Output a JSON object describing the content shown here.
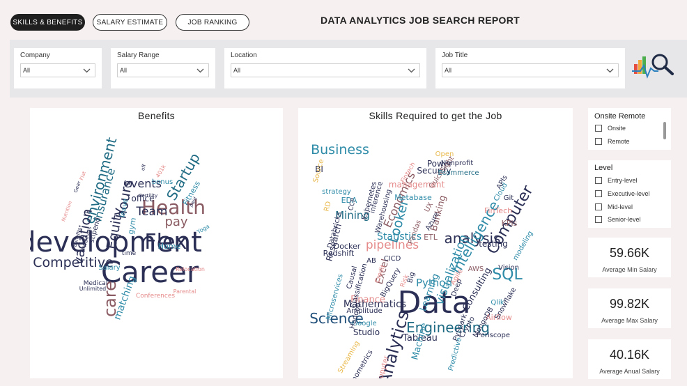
{
  "tabs": {
    "skills_benefits": "SKILLS & BENEFITS",
    "salary_estimate": "SALARY ESTIMATE",
    "job_ranking": "JOB RANKING"
  },
  "header": {
    "title": "DATA ANALYTICS JOB SEARCH REPORT"
  },
  "filters": {
    "company": {
      "label": "Company",
      "value": "All"
    },
    "salary_range": {
      "label": "Salary Range",
      "value": "All"
    },
    "location": {
      "label": "Location",
      "value": "All"
    },
    "job_title": {
      "label": "Job Title",
      "value": "All"
    }
  },
  "icons": {
    "logo": "analytics-magnifier-icon",
    "dropdown": "chevron-down-icon",
    "checkbox": "checkbox-icon"
  },
  "benefits": {
    "title": "Benefits",
    "words": [
      {
        "t": "development",
        "c": "#2b2f55"
      },
      {
        "t": "Career",
        "c": "#2b2f55"
      },
      {
        "t": "Health",
        "c": "#8a5b62"
      },
      {
        "t": "Flex",
        "c": "#2b2f55"
      },
      {
        "t": "care",
        "c": "#8a5b62"
      },
      {
        "t": "environment",
        "c": "#1f6b84"
      },
      {
        "t": "Competitive",
        "c": "#2b2f55"
      },
      {
        "t": "Startup",
        "c": "#1f6b84"
      },
      {
        "t": "hours",
        "c": "#2b2f55"
      },
      {
        "t": "vacation",
        "c": "#2b2f55"
      },
      {
        "t": "Equity",
        "c": "#2b2f55"
      },
      {
        "t": "Team",
        "c": "#2b2f55"
      },
      {
        "t": "pay",
        "c": "#8a5b62"
      },
      {
        "t": "events",
        "c": "#2b2f55"
      },
      {
        "t": "Insurance",
        "c": "#1f6b84"
      },
      {
        "t": "matching",
        "c": "#2e8ba8"
      },
      {
        "t": "office",
        "c": "#2b2f55"
      },
      {
        "t": "Fitness",
        "c": "#2e8ba8"
      },
      {
        "t": "gym",
        "c": "#2e8ba8"
      },
      {
        "t": "Home",
        "c": "#2e8ba8"
      },
      {
        "t": "leave",
        "c": "#2e8ba8"
      },
      {
        "t": "Salary",
        "c": "#2e8ba8"
      },
      {
        "t": "bonus",
        "c": "#2e8ba8"
      },
      {
        "t": "stipend",
        "c": "#2b2f55"
      },
      {
        "t": "Medical",
        "c": "#2b2f55"
      },
      {
        "t": "Unlimited",
        "c": "#2b2f55"
      },
      {
        "t": "Conferences",
        "c": "#e58a8a"
      },
      {
        "t": "Parental",
        "c": "#e58a8a"
      },
      {
        "t": "Relocation",
        "c": "#e58a8a"
      },
      {
        "t": "401k",
        "c": "#e58a8a"
      },
      {
        "t": "k",
        "c": "#2b2f55"
      },
      {
        "t": "time",
        "c": "#2b2f55"
      },
      {
        "t": "Wellness",
        "c": "#2b2f55"
      },
      {
        "t": "benefits",
        "c": "#2b2f55"
      },
      {
        "t": "Yoga",
        "c": "#2e8ba8"
      },
      {
        "t": "Flat",
        "c": "#e58a8a"
      },
      {
        "t": "Gear",
        "c": "#2b2f55"
      },
      {
        "t": "paid",
        "c": "#2b2f55"
      },
      {
        "t": "off",
        "c": "#2b2f55"
      },
      {
        "t": "Fertility",
        "c": "#2b2f55"
      },
      {
        "t": "Nutrition",
        "c": "#e58a8a"
      }
    ]
  },
  "skills": {
    "title": "Skills Required to get the Job",
    "words": [
      {
        "t": "Data",
        "c": "#2b2f55"
      },
      {
        "t": "Engineering",
        "c": "#1f6b84"
      },
      {
        "t": "Analytics",
        "c": "#2b2f55"
      },
      {
        "t": "Science",
        "c": "#1f4e79"
      },
      {
        "t": "SQL",
        "c": "#2e8ba8"
      },
      {
        "t": "Business",
        "c": "#2e8ba8"
      },
      {
        "t": "Computer",
        "c": "#2b2f55"
      },
      {
        "t": "analysis",
        "c": "#2b2f55"
      },
      {
        "t": "Intelligence",
        "c": "#2e8ba8"
      },
      {
        "t": "visualization",
        "c": "#2e8ba8"
      },
      {
        "t": "Python",
        "c": "#2e8ba8"
      },
      {
        "t": "pipelines",
        "c": "#e58a8a"
      },
      {
        "t": "Mining",
        "c": "#1f6b84"
      },
      {
        "t": "Looker",
        "c": "#2e8ba8"
      },
      {
        "t": "Statistics",
        "c": "#2e8ba8"
      },
      {
        "t": "Economics",
        "c": "#8a5b62"
      },
      {
        "t": "Mathematics",
        "c": "#2b2f55"
      },
      {
        "t": "Excel",
        "c": "#8a5b62"
      },
      {
        "t": "Finance",
        "c": "#e58a8a"
      },
      {
        "t": "Tableau",
        "c": "#2b2f55"
      },
      {
        "t": "Consulting",
        "c": "#2b2f55"
      },
      {
        "t": "Machine",
        "c": "#2e8ba8"
      },
      {
        "t": "Learning",
        "c": "#2e8ba8"
      },
      {
        "t": "Research",
        "c": "#2b2f55"
      },
      {
        "t": "Banking",
        "c": "#8a5b62"
      },
      {
        "t": "Security",
        "c": "#2b2f55"
      },
      {
        "t": "management",
        "c": "#e58a8a"
      },
      {
        "t": "Power",
        "c": "#2b2f55"
      },
      {
        "t": "BI",
        "c": "#2b2f55"
      },
      {
        "t": "QuickSight",
        "c": "#8a5b62"
      },
      {
        "t": "Nonprofit",
        "c": "#2b2f55"
      },
      {
        "t": "Ecommerce",
        "c": "#1f6b84"
      },
      {
        "t": "Git",
        "c": "#2b2f55"
      },
      {
        "t": "APIs",
        "c": "#2b2f55"
      },
      {
        "t": "Cloud",
        "c": "#2e8ba8"
      },
      {
        "t": "FinTech",
        "c": "#e58a8a"
      },
      {
        "t": "KPIs",
        "c": "#8a5b62"
      },
      {
        "t": "testing",
        "c": "#2b2f55"
      },
      {
        "t": "modeling",
        "c": "#2e8ba8"
      },
      {
        "t": "Vision",
        "c": "#2b2f55"
      },
      {
        "t": "AWS",
        "c": "#8a5b62"
      },
      {
        "t": "Qlik",
        "c": "#2e8ba8"
      },
      {
        "t": "Airflow",
        "c": "#e58a8a"
      },
      {
        "t": "Periscope",
        "c": "#2b2f55"
      },
      {
        "t": "Snowflake",
        "c": "#2b2f55"
      },
      {
        "t": "MongoDB",
        "c": "#2b2f55"
      },
      {
        "t": "PySpark",
        "c": "#2b2f55"
      },
      {
        "t": "Predictive",
        "c": "#2e8ba8"
      },
      {
        "t": "Crypto",
        "c": "#2b2f55"
      },
      {
        "t": "Studio",
        "c": "#2b2f55"
      },
      {
        "t": "Google",
        "c": "#2e8ba8"
      },
      {
        "t": "Amplitude",
        "c": "#2b2f55"
      },
      {
        "t": "Hadoop",
        "c": "#2b2f55"
      },
      {
        "t": "Microservices",
        "c": "#2e8ba8"
      },
      {
        "t": "Redshift",
        "c": "#2b2f55"
      },
      {
        "t": "Docker",
        "c": "#2b2f55"
      },
      {
        "t": "Databricks",
        "c": "#2b2f55"
      },
      {
        "t": "EDA",
        "c": "#2e8ba8"
      },
      {
        "t": "RD",
        "c": "#e9b84a"
      },
      {
        "t": "Source",
        "c": "#e9b84a"
      },
      {
        "t": "Open",
        "c": "#e9b84a"
      },
      {
        "t": "strategy",
        "c": "#2e8ba8"
      },
      {
        "t": "Kubernetes",
        "c": "#2b2f55"
      },
      {
        "t": "inference",
        "c": "#2b2f55"
      },
      {
        "t": "Warehousing",
        "c": "#2b2f55"
      },
      {
        "t": "Metabase",
        "c": "#2e8ba8"
      },
      {
        "t": "Pandas",
        "c": "#8a5b62"
      },
      {
        "t": "ETL",
        "c": "#8a5b62"
      },
      {
        "t": "UX",
        "c": "#8a5b62"
      },
      {
        "t": "Azure",
        "c": "#2b2f55"
      },
      {
        "t": "CICD",
        "c": "#2b2f55"
      },
      {
        "t": "AB",
        "c": "#2b2f55"
      },
      {
        "t": "Causal",
        "c": "#2b2f55"
      },
      {
        "t": "Classification",
        "c": "#2b2f55"
      },
      {
        "t": "BigQuery",
        "c": "#2b2f55"
      },
      {
        "t": "Big",
        "c": "#2b2f55"
      },
      {
        "t": "Deep",
        "c": "#2b2f55"
      },
      {
        "t": "Agile",
        "c": "#e58a8a"
      },
      {
        "t": "Streaming",
        "c": "#e9b84a"
      },
      {
        "t": "Jupyter",
        "c": "#e58a8a"
      },
      {
        "t": "Econometrics",
        "c": "#2b2f55"
      },
      {
        "t": "Credit",
        "c": "#e58a8a"
      },
      {
        "t": "Risk",
        "c": "#e58a8a"
      },
      {
        "t": "CCP",
        "c": "#2b2f55"
      },
      {
        "t": "Fintech",
        "c": "#e58a8a"
      }
    ]
  },
  "onsite_remote": {
    "title": "Onsite Remote",
    "options": [
      "Onsite",
      "Remote"
    ]
  },
  "level": {
    "title": "Level",
    "options": [
      "Entry-level",
      "Executive-level",
      "Mid-level",
      "Senior-level"
    ]
  },
  "kpis": [
    {
      "value": "59.66K",
      "label": "Average Min Salary"
    },
    {
      "value": "99.82K",
      "label": "Average Max Salary"
    },
    {
      "value": "40.16K",
      "label": "Average Anual Salary"
    }
  ],
  "colors": {
    "navy": "#2b2f55",
    "teal": "#2e8ba8",
    "mauve": "#8a5b62",
    "pink": "#e58a8a",
    "gold": "#e9b84a",
    "header_bg": "#e7e7ea",
    "page_bg": "#f6f0f0"
  }
}
